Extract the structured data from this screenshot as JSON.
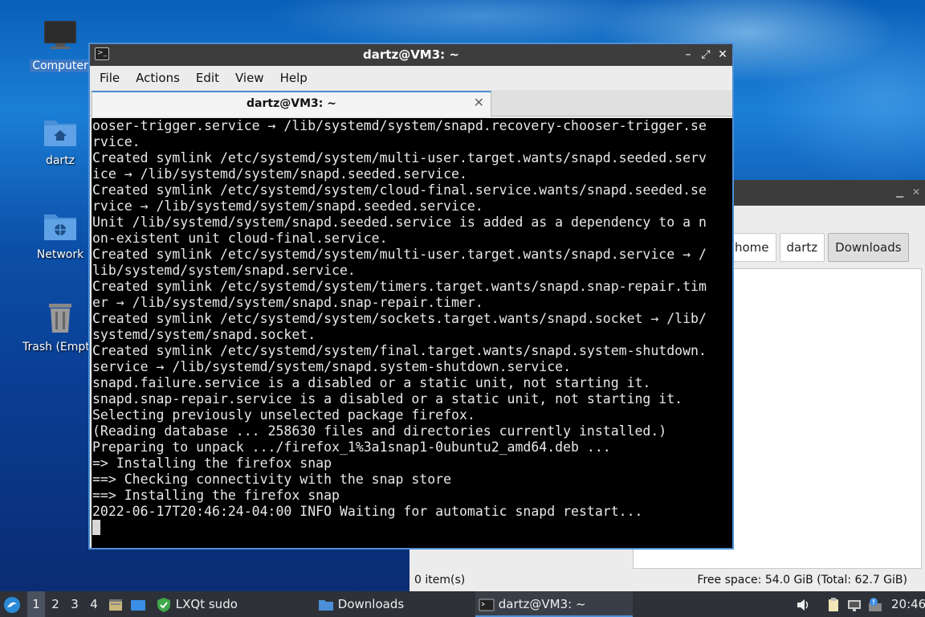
{
  "desktop": {
    "icons": [
      {
        "label": "Computer",
        "icon": "computer-icon"
      },
      {
        "label": "dartz",
        "icon": "home-folder-icon"
      },
      {
        "label": "Network",
        "icon": "network-folder-icon"
      },
      {
        "label": "Trash (Empty)",
        "icon": "trash-icon"
      }
    ]
  },
  "file_manager": {
    "breadcrumbs": [
      "home",
      "dartz",
      "Downloads"
    ],
    "status_items": "0 item(s)",
    "status_space": "Free space: 54.0 GiB (Total: 62.7 GiB)"
  },
  "terminal": {
    "title": "dartz@VM3: ~",
    "menu": [
      "File",
      "Actions",
      "Edit",
      "View",
      "Help"
    ],
    "tab_label": "dartz@VM3: ~",
    "lines": [
      "ooser-trigger.service → /lib/systemd/system/snapd.recovery-chooser-trigger.se",
      "rvice.",
      "Created symlink /etc/systemd/system/multi-user.target.wants/snapd.seeded.serv",
      "ice → /lib/systemd/system/snapd.seeded.service.",
      "Created symlink /etc/systemd/system/cloud-final.service.wants/snapd.seeded.se",
      "rvice → /lib/systemd/system/snapd.seeded.service.",
      "Unit /lib/systemd/system/snapd.seeded.service is added as a dependency to a n",
      "on-existent unit cloud-final.service.",
      "Created symlink /etc/systemd/system/multi-user.target.wants/snapd.service → /",
      "lib/systemd/system/snapd.service.",
      "Created symlink /etc/systemd/system/timers.target.wants/snapd.snap-repair.tim",
      "er → /lib/systemd/system/snapd.snap-repair.timer.",
      "Created symlink /etc/systemd/system/sockets.target.wants/snapd.socket → /lib/",
      "systemd/system/snapd.socket.",
      "Created symlink /etc/systemd/system/final.target.wants/snapd.system-shutdown.",
      "service → /lib/systemd/system/snapd.system-shutdown.service.",
      "snapd.failure.service is a disabled or a static unit, not starting it.",
      "snapd.snap-repair.service is a disabled or a static unit, not starting it.",
      "Selecting previously unselected package firefox.",
      "(Reading database ... 258630 files and directories currently installed.)",
      "Preparing to unpack .../firefox_1%3a1snap1-0ubuntu2_amd64.deb ...",
      "=> Installing the firefox snap",
      "==> Checking connectivity with the snap store",
      "==> Installing the firefox snap",
      "2022-06-17T20:46:24-04:00 INFO Waiting for automatic snapd restart..."
    ]
  },
  "taskbar": {
    "workspaces": [
      "1",
      "2",
      "3",
      "4"
    ],
    "active_workspace": "1",
    "tasks": [
      {
        "label": "LXQt sudo",
        "icon": "shield-check-icon"
      },
      {
        "label": "Downloads",
        "icon": "folder-icon"
      },
      {
        "label": "dartz@VM3: ~",
        "icon": "terminal-icon"
      }
    ],
    "clock": "20:46"
  },
  "colors": {
    "accent": "#4d8fd6",
    "panel": "#2e3238",
    "titlebar": "#3d3d3d"
  }
}
